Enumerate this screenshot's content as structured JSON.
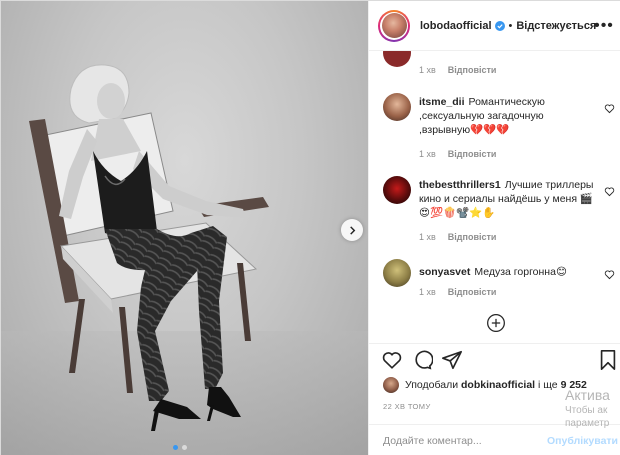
{
  "header": {
    "username": "lobodaofficial",
    "separator": "•",
    "follow_state": "Відстежується"
  },
  "comments": [
    {
      "username": "",
      "text": "",
      "time": "1 хв",
      "reply": "Відповісти"
    },
    {
      "username": "itsme_dii",
      "text": "Романтическую ,сексуальную загадочную ,взрывную💔💔💔",
      "time": "1 хв",
      "reply": "Відповісти"
    },
    {
      "username": "thebestthrillers1",
      "text": "Лучшие триллеры кино и сериалы найдёшь у меня 🎬 😍💯🍿📽️⭐✋",
      "time": "1 хв",
      "reply": "Відповісти"
    },
    {
      "username": "sonyasvet",
      "text": "Медуза горгонна😊",
      "time": "1 хв",
      "reply": "Відповісти"
    }
  ],
  "likes": {
    "prefix": "Уподобали",
    "user": "dobkinaofficial",
    "suffix": "і ще",
    "count": "9 252"
  },
  "timestamp": "22 хв тому",
  "composer": {
    "placeholder": "Додайте коментар...",
    "publish_label": "Опублікувати"
  },
  "carousel": {
    "total": 2,
    "current": 1
  },
  "watermark": {
    "line1": "Актива",
    "line2": "Чтобы ак",
    "line3": "параметр"
  },
  "colors": {
    "verified_blue": "#3897f0",
    "text": "#262626",
    "muted": "#8e8e8e",
    "publish_disabled": "#b3dbff",
    "heart_red": "#ed4956"
  }
}
